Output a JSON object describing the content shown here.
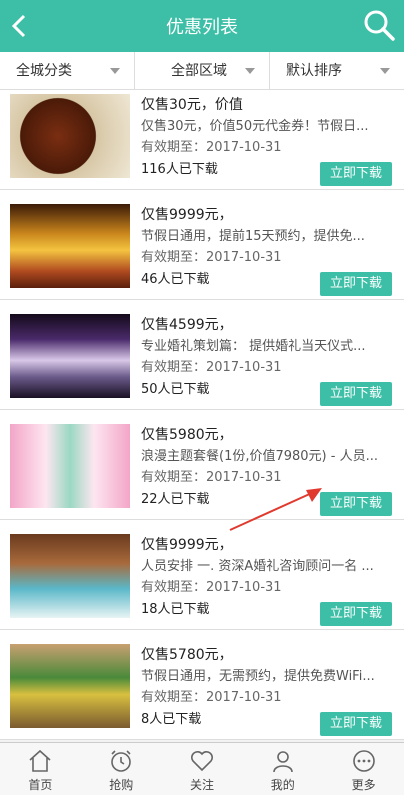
{
  "header": {
    "title": "优惠列表"
  },
  "filters": [
    "全城分类",
    "全部区域",
    "默认排序"
  ],
  "items": [
    {
      "t1": "仅售30元，价值",
      "t2": "仅售30元，价值50元代金券！节假日...",
      "t3": "有效期至：2017-10-31",
      "t4": "116人已下载",
      "btn": "立即下载"
    },
    {
      "t1": "仅售9999元，",
      "t2": "节假日通用，提前15天预约，提供免...",
      "t3": "有效期至：2017-10-31",
      "t4": "46人已下载",
      "btn": "立即下载"
    },
    {
      "t1": "仅售4599元，",
      "t2": "专业婚礼策划篇： 提供婚礼当天仪式...",
      "t3": "有效期至：2017-10-31",
      "t4": "50人已下载",
      "btn": "立即下载"
    },
    {
      "t1": "仅售5980元，",
      "t2": "浪漫主题套餐(1份,价值7980元) - 人员...",
      "t3": "有效期至：2017-10-31",
      "t4": "22人已下载",
      "btn": "立即下载"
    },
    {
      "t1": "仅售9999元，",
      "t2": "人员安排 一. 资深A婚礼咨询顾问一名 ...",
      "t3": "有效期至：2017-10-31",
      "t4": "18人已下载",
      "btn": "立即下载"
    },
    {
      "t1": "仅售5780元，",
      "t2": "节假日通用，无需预约，提供免费WiFi...",
      "t3": "有效期至：2017-10-31",
      "t4": "8人已下载",
      "btn": "立即下载"
    }
  ],
  "tabs": [
    "首页",
    "抢购",
    "关注",
    "我的",
    "更多"
  ]
}
